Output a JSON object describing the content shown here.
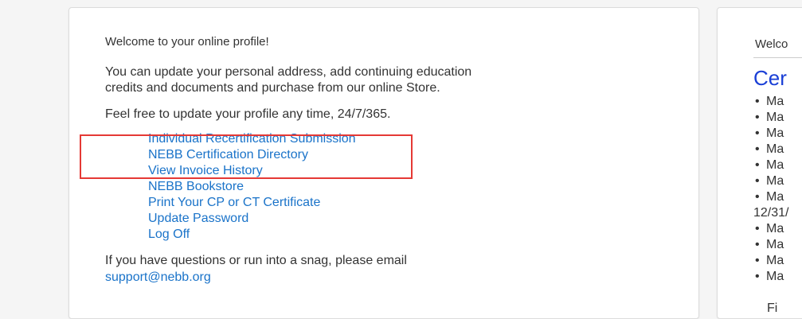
{
  "left": {
    "welcome": "Welcome to your online profile!",
    "intro_line1": "You can update your personal address, add continuing education",
    "intro_line2": "credits and documents and purchase from our online Store.",
    "feel_free": "Feel free to update your profile any time, 24/7/365.",
    "links": [
      "Individual Recertification Submission",
      "NEBB Certification Directory",
      "View Invoice History",
      "NEBB Bookstore",
      "Print Your CP or CT Certificate",
      "Update Password",
      "Log Off"
    ],
    "questions": "If you have questions or run into a snag, please email",
    "support_email": "support@nebb.org"
  },
  "right": {
    "welcome": "Welco",
    "title": "Cer",
    "bullet": "•",
    "items": [
      "Ma",
      "Ma",
      "Ma",
      "Ma",
      "Ma",
      "Ma",
      "Ma"
    ],
    "date_fragment": "12/31/",
    "items2": [
      "Ma",
      "Ma",
      "Ma",
      "Ma"
    ],
    "bottom_fragment": "Fi"
  },
  "colors": {
    "link": "#1a73c9",
    "title": "#1a3fd6",
    "highlight": "#e53935"
  }
}
